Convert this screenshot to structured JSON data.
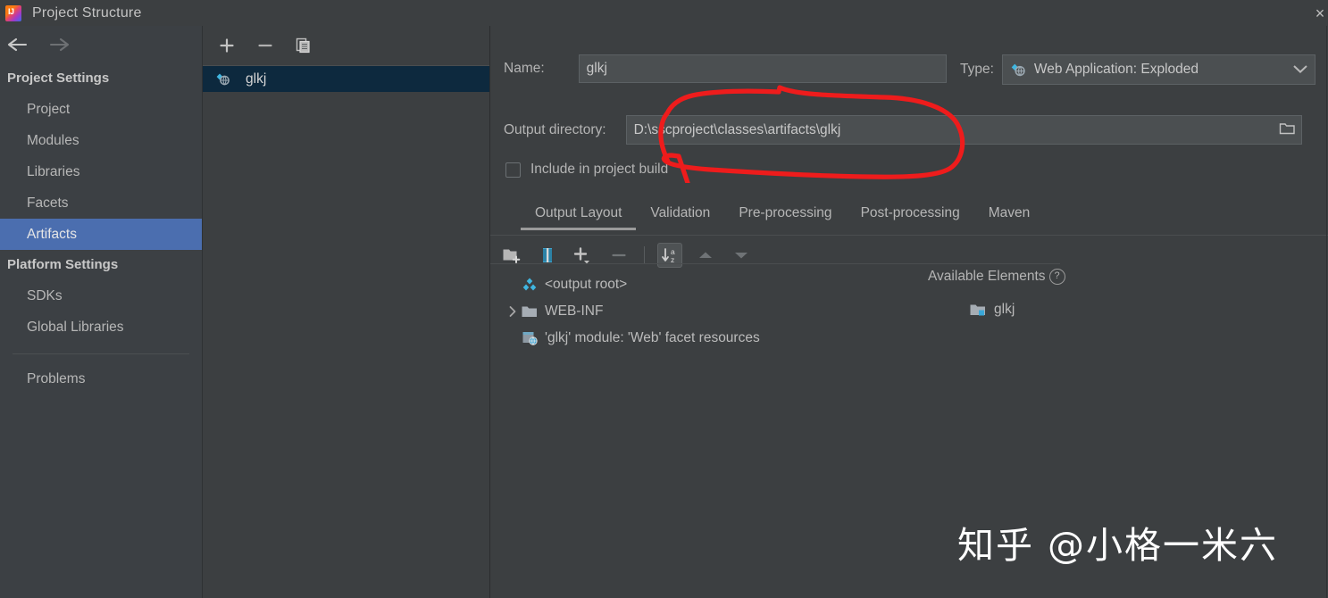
{
  "window": {
    "title": "Project Structure",
    "logo_text": "IJ",
    "close_label": "×"
  },
  "nav": {
    "back_icon": "arrow-left-icon",
    "forward_icon": "arrow-right-icon"
  },
  "sidebar": {
    "groups": [
      {
        "title": "Project Settings",
        "items": [
          {
            "label": "Project",
            "selected": false
          },
          {
            "label": "Modules",
            "selected": false
          },
          {
            "label": "Libraries",
            "selected": false
          },
          {
            "label": "Facets",
            "selected": false
          },
          {
            "label": "Artifacts",
            "selected": true
          }
        ]
      },
      {
        "title": "Platform Settings",
        "items": [
          {
            "label": "SDKs",
            "selected": false
          },
          {
            "label": "Global Libraries",
            "selected": false
          }
        ]
      }
    ],
    "problems_label": "Problems"
  },
  "artifacts_panel": {
    "toolbar": [
      {
        "name": "add-artifact-button",
        "label": "+"
      },
      {
        "name": "remove-artifact-button",
        "label": "−"
      },
      {
        "name": "copy-artifact-button",
        "label": "copy-icon"
      }
    ],
    "items": [
      {
        "label": "glkj",
        "icon": "artifact-icon",
        "selected": true
      }
    ]
  },
  "main": {
    "name_field": {
      "label": "Name:",
      "value": "glkj",
      "placeholder": ""
    },
    "type_field": {
      "label": "Type:",
      "value": "Web Application: Exploded",
      "icon": "artifact-icon",
      "arrow_icon": "chevron-down-icon"
    },
    "output_directory": {
      "label": "Output directory:",
      "value": "D:\\sscproject\\classes\\artifacts\\glkj",
      "browse_icon": "folder-browse-icon"
    },
    "include_in_build": {
      "label": "Include in project build",
      "checked": false
    },
    "tabs": [
      {
        "label": "Output Layout",
        "active": true
      },
      {
        "label": "Validation",
        "active": false
      },
      {
        "label": "Pre-processing",
        "active": false
      },
      {
        "label": "Post-processing",
        "active": false
      },
      {
        "label": "Maven",
        "active": false
      }
    ],
    "layout_toolbar": [
      {
        "name": "create-directory-button",
        "icon": "folder-add-icon",
        "state": "enabled"
      },
      {
        "name": "create-archive-button",
        "icon": "archive-icon",
        "state": "enabled"
      },
      {
        "name": "add-copy-of-button",
        "icon": "plus-dropdown-icon",
        "state": "enabled"
      },
      {
        "name": "remove-element-button",
        "icon": "minus-icon",
        "state": "disabled"
      },
      {
        "name": "sort-alphabetically-button",
        "icon": "sort-az-icon",
        "state": "toggled"
      },
      {
        "name": "move-up-button",
        "icon": "triangle-up-icon",
        "state": "disabled"
      },
      {
        "name": "move-down-button",
        "icon": "triangle-down-icon",
        "state": "disabled"
      }
    ],
    "output_tree": [
      {
        "label": "<output root>",
        "icon": "artifact-icon",
        "depth": 0,
        "expandable": false
      },
      {
        "label": "WEB-INF",
        "icon": "folder-icon",
        "depth": 1,
        "expandable": true,
        "expanded": false
      },
      {
        "label": "'glkj' module: 'Web' facet resources",
        "icon": "web-facet-icon",
        "depth": 1,
        "expandable": false
      }
    ],
    "available_elements": {
      "title": "Available Elements",
      "help_label": "?",
      "items": [
        {
          "label": "glkj",
          "icon": "module-folder-icon"
        }
      ]
    }
  },
  "annotation": {
    "type": "hand-drawn-circle",
    "color": "#ee1c1c",
    "target": "output-directory-field"
  },
  "watermark": {
    "text": "知乎 @小格一米六"
  },
  "colors": {
    "window_bg": "#3c3f41",
    "sidebar_bg": "#3c4044",
    "selection_blue": "#4b6eaf",
    "list_selection": "#0d293e",
    "field_bg": "#4b4f51",
    "text": "#bbbbbb",
    "annotation_red": "#ee1c1c"
  }
}
